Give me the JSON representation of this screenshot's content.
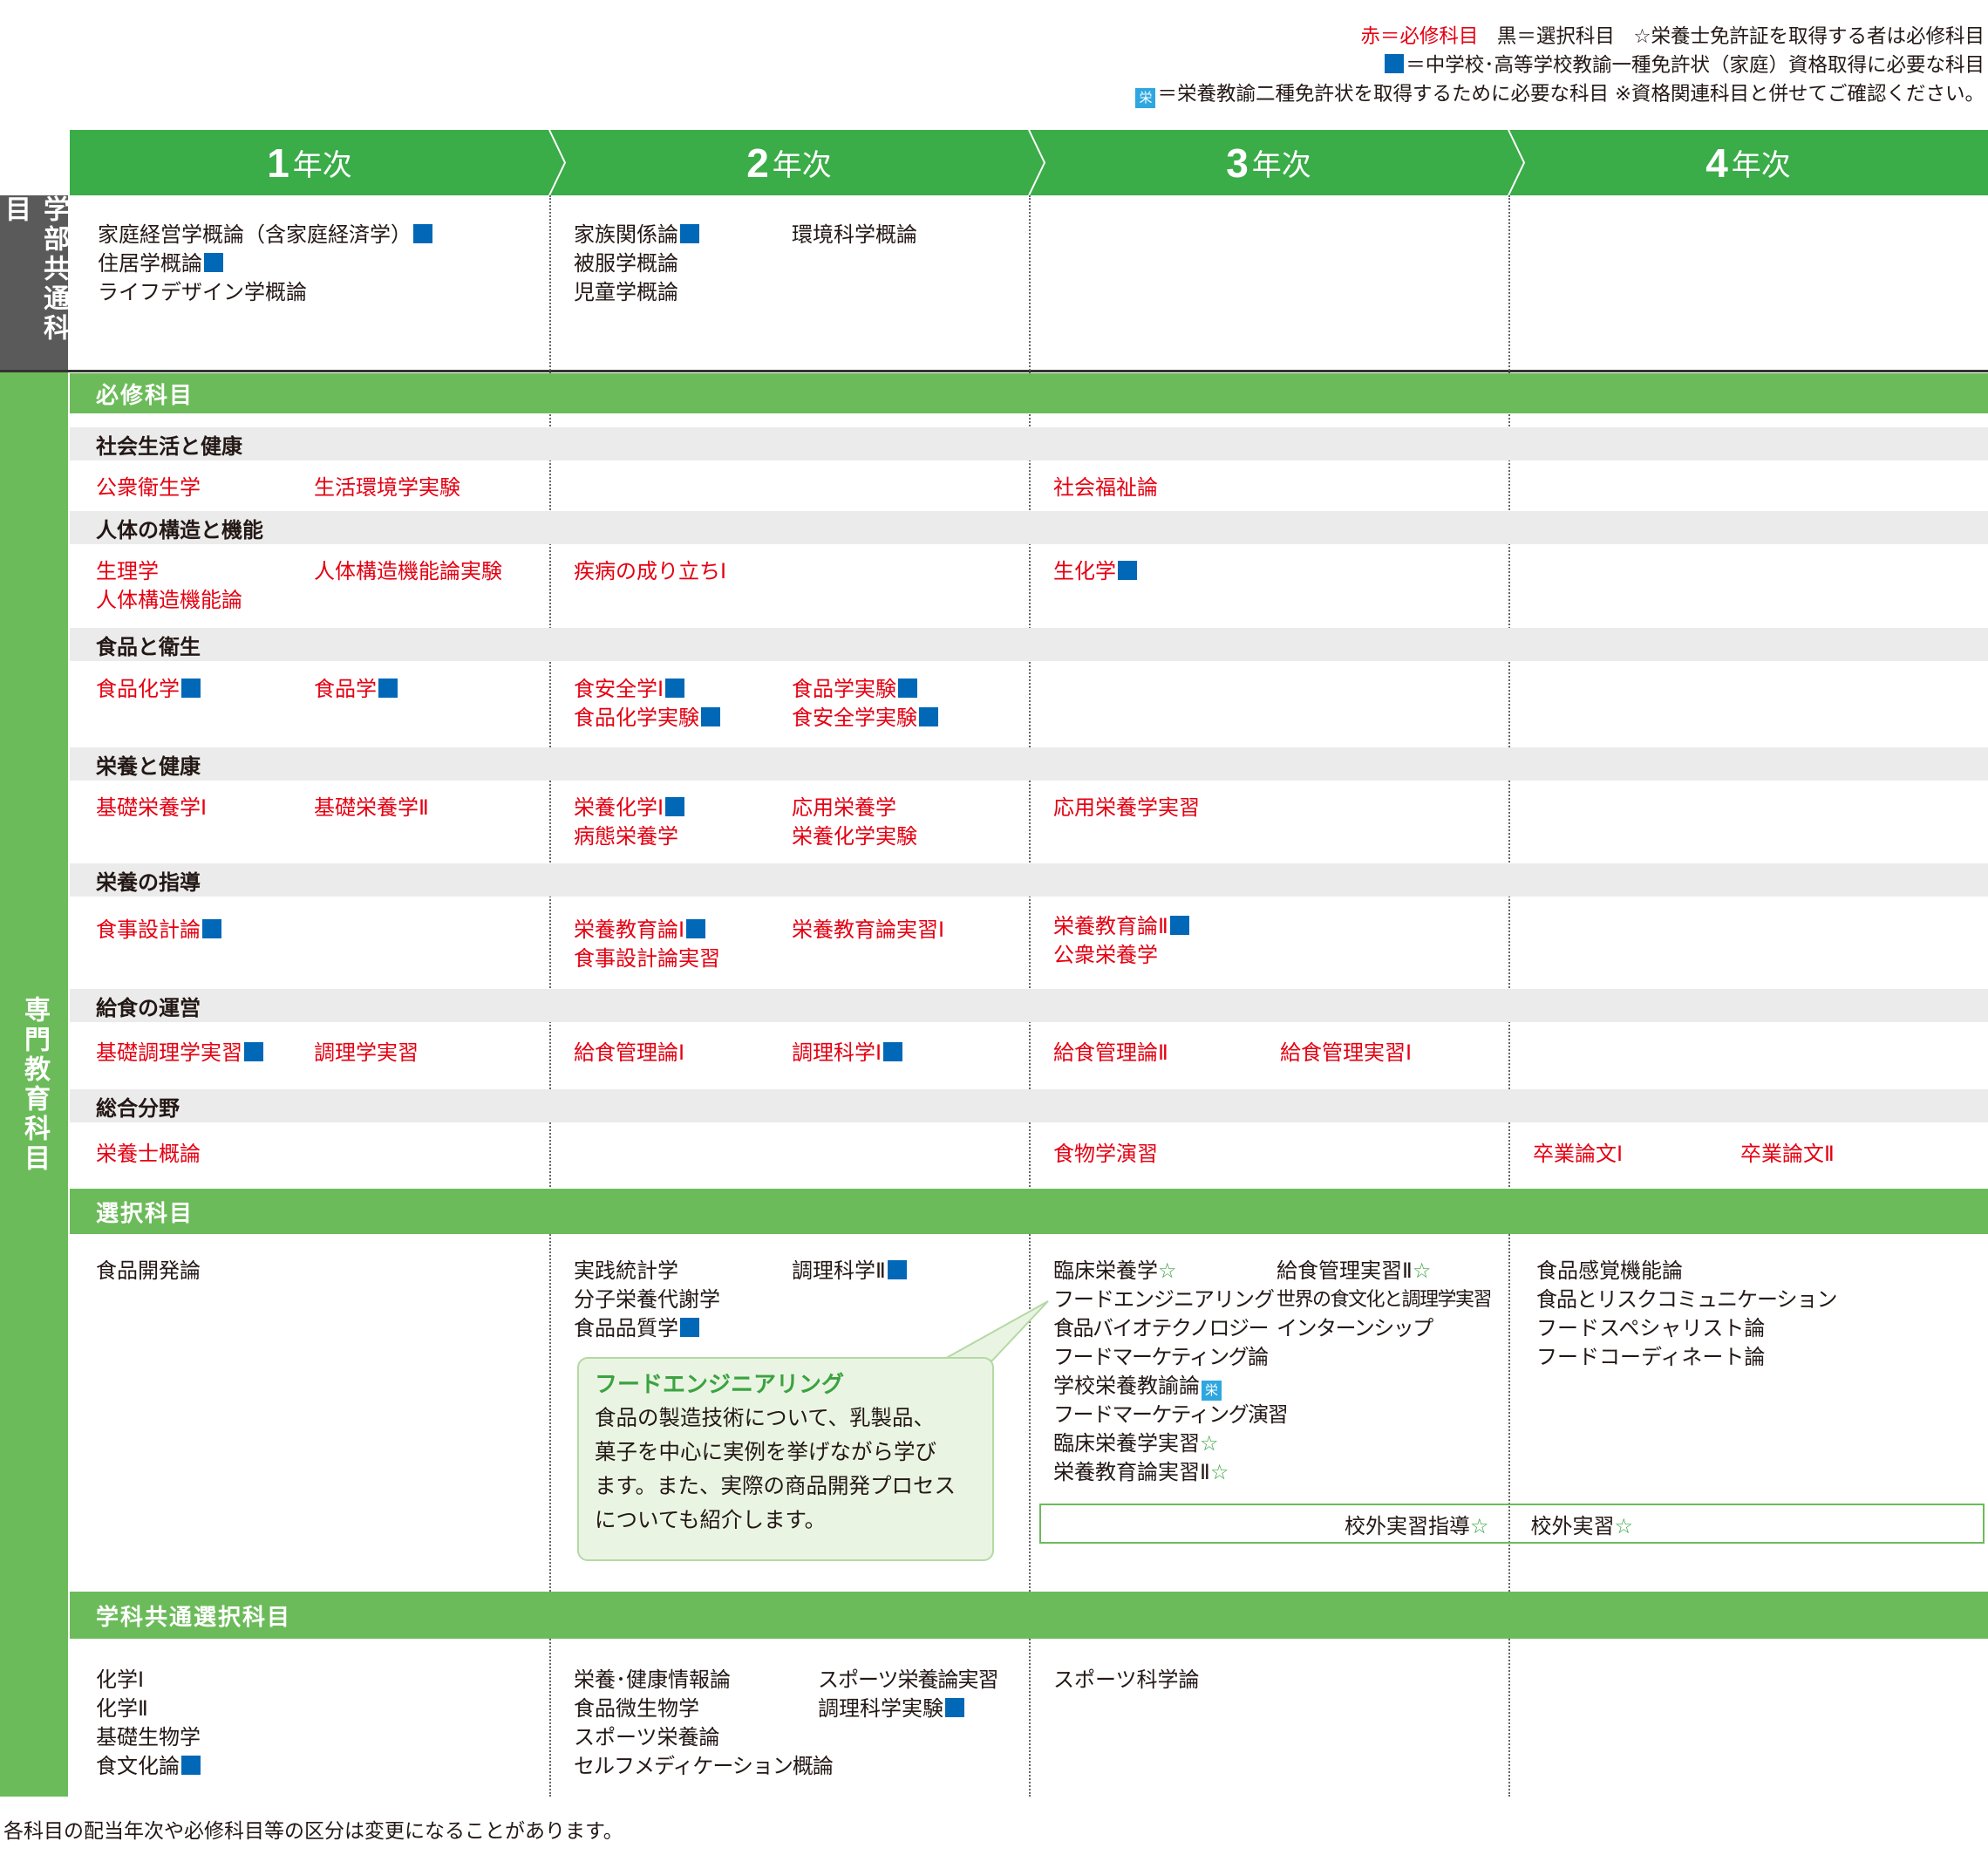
{
  "legend": {
    "red_required": "赤＝必修科目",
    "black_elective": "黒＝選択科目",
    "star_note": "☆栄養士免許証を取得する者は必修科目",
    "blue_note": "＝中学校･高等学校教諭一種免許状（家庭）資格取得に必要な科目",
    "eiyo_mark": "栄",
    "eiyo_note": "＝栄養教諭二種免許状を取得するために必要な科目 ※資格関連科目と併せてご確認ください。"
  },
  "years": [
    {
      "num": "1",
      "label": "年次"
    },
    {
      "num": "2",
      "label": "年次"
    },
    {
      "num": "3",
      "label": "年次"
    },
    {
      "num": "4",
      "label": "年次"
    }
  ],
  "side_labels": {
    "common": "学部共通科目",
    "major": "専門教育科目"
  },
  "sections": {
    "required": "必修科目",
    "social": "社会生活と健康",
    "body": "人体の構造と機能",
    "food": "食品と衛生",
    "nutrition": "栄養と健康",
    "guidance": "栄養の指導",
    "catering": "給食の運営",
    "general": "総合分野",
    "elective": "選択科目",
    "dept_elective": "学科共通選択科目"
  },
  "common": {
    "y1": [
      "家庭経営学概論（含家庭経済学）",
      "住居学概論",
      "ライフデザイン学概論"
    ],
    "y2a": [
      "家族関係論",
      "被服学概論",
      "児童学概論"
    ],
    "y2b": [
      "環境科学概論"
    ]
  },
  "required": {
    "social": {
      "y1a": "公衆衛生学",
      "y1b": "生活環境学実験",
      "y3": "社会福祉論"
    },
    "body": {
      "y1a1": "生理学",
      "y1a2": "人体構造機能論",
      "y1b": "人体構造機能論実験",
      "y2": "疾病の成り立ちⅠ",
      "y3": "生化学"
    },
    "food": {
      "y1a": "食品化学",
      "y1b": "食品学",
      "y2a1": "食安全学Ⅰ",
      "y2a2": "食品化学実験",
      "y2b1": "食品学実験",
      "y2b2": "食安全学実験"
    },
    "nutrition": {
      "y1a": "基礎栄養学Ⅰ",
      "y1b": "基礎栄養学Ⅱ",
      "y2a1": "栄養化学Ⅰ",
      "y2a2": "病態栄養学",
      "y2b1": "応用栄養学",
      "y2b2": "栄養化学実験",
      "y3": "応用栄養学実習"
    },
    "guidance": {
      "y1": "食事設計論",
      "y2a1": "栄養教育論Ⅰ",
      "y2a2": "食事設計論実習",
      "y2b": "栄養教育論実習Ⅰ",
      "y3a1": "栄養教育論Ⅱ",
      "y3a2": "公衆栄養学"
    },
    "catering": {
      "y1a": "基礎調理学実習",
      "y1b": "調理学実習",
      "y2a": "給食管理論Ⅰ",
      "y2b": "調理科学Ⅰ",
      "y3a": "給食管理論Ⅱ",
      "y3b": "給食管理実習Ⅰ"
    },
    "general": {
      "y1": "栄養士概論",
      "y3": "食物学演習",
      "y4a": "卒業論文Ⅰ",
      "y4b": "卒業論文Ⅱ"
    }
  },
  "elective": {
    "y1": [
      "食品開発論"
    ],
    "y2a": [
      "実践統計学",
      "分子栄養代謝学",
      "食品品質学"
    ],
    "y2b": [
      "調理科学Ⅱ"
    ],
    "y3a": [
      "臨床栄養学",
      "フードエンジニアリング",
      "食品バイオテクノロジー",
      "フードマーケティング論",
      "学校栄養教諭論",
      "フードマーケティング演習",
      "臨床栄養学実習",
      "栄養教育論実習Ⅱ"
    ],
    "y3b": [
      "給食管理実習Ⅱ",
      "世界の食文化と調理学実習",
      "インターンシップ"
    ],
    "y4": [
      "食品感覚機能論",
      "食品とリスクコミュニケーション",
      "フードスペシャリスト論",
      "フードコーディネート論"
    ],
    "outside": [
      "校外実習指導",
      "校外実習"
    ]
  },
  "callout": {
    "title": "フードエンジニアリング",
    "lines": [
      "食品の製造技術について、乳製品、",
      "菓子を中心に実例を挙げながら学び",
      "ます。また、実際の商品開発プロセス",
      "についても紹介します。"
    ]
  },
  "dept_elective": {
    "y1": [
      "化学Ⅰ",
      "化学Ⅱ",
      "基礎生物学",
      "食文化論"
    ],
    "y2a": [
      "栄養･健康情報論",
      "食品微生物学",
      "スポーツ栄養論",
      "セルフメディケーション概論"
    ],
    "y2b": [
      "スポーツ栄養論実習",
      "調理科学実験"
    ],
    "y3": [
      "スポーツ科学論"
    ]
  },
  "footnote": "各科目の配当年次や必修科目等の区分は変更になることがあります。",
  "colors": {
    "green_header": "#3aac48",
    "green_bar": "#6cbb5a",
    "side_gray": "#5a5a5a",
    "red": "#e50012",
    "blue_mark": "#0068b7",
    "eiyo_mark": "#2ea7e0"
  }
}
